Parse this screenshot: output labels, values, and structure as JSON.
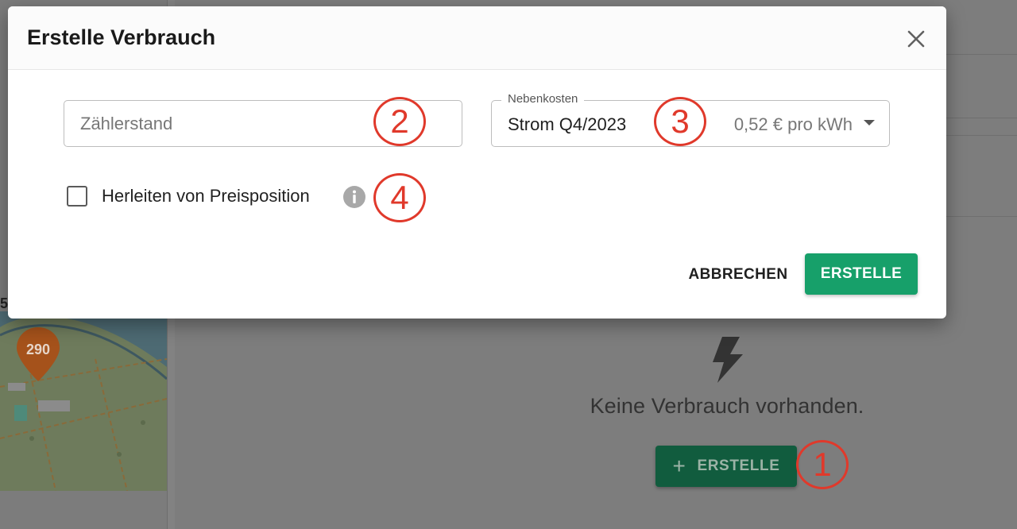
{
  "dialog": {
    "title": "Erstelle Verbrauch",
    "meter_field": {
      "placeholder": "Zählerstand",
      "value": ""
    },
    "cost_select": {
      "label": "Nebenkosten",
      "selected": "Strom Q4/2023",
      "price": "0,52 € pro kWh"
    },
    "derive_checkbox": {
      "label": "Herleiten von Preisposition",
      "checked": false
    },
    "cancel_label": "ABBRECHEN",
    "create_label": "ERSTELLE"
  },
  "background": {
    "empty_text": "Keine Verbrauch vorhanden.",
    "create_label": "ERSTELLE",
    "map_marker": "290",
    "map_corner_digit": "5"
  },
  "annotations": [
    "1",
    "2",
    "3",
    "4"
  ],
  "colors": {
    "primary": "#17a06a",
    "annotation": "#e0392b",
    "map_marker": "#a5521b"
  },
  "icons": {
    "close": "close-icon",
    "info": "info-icon",
    "dropdown": "chevron-down-icon",
    "bolt": "lightning-bolt-icon",
    "plus": "plus-icon"
  }
}
